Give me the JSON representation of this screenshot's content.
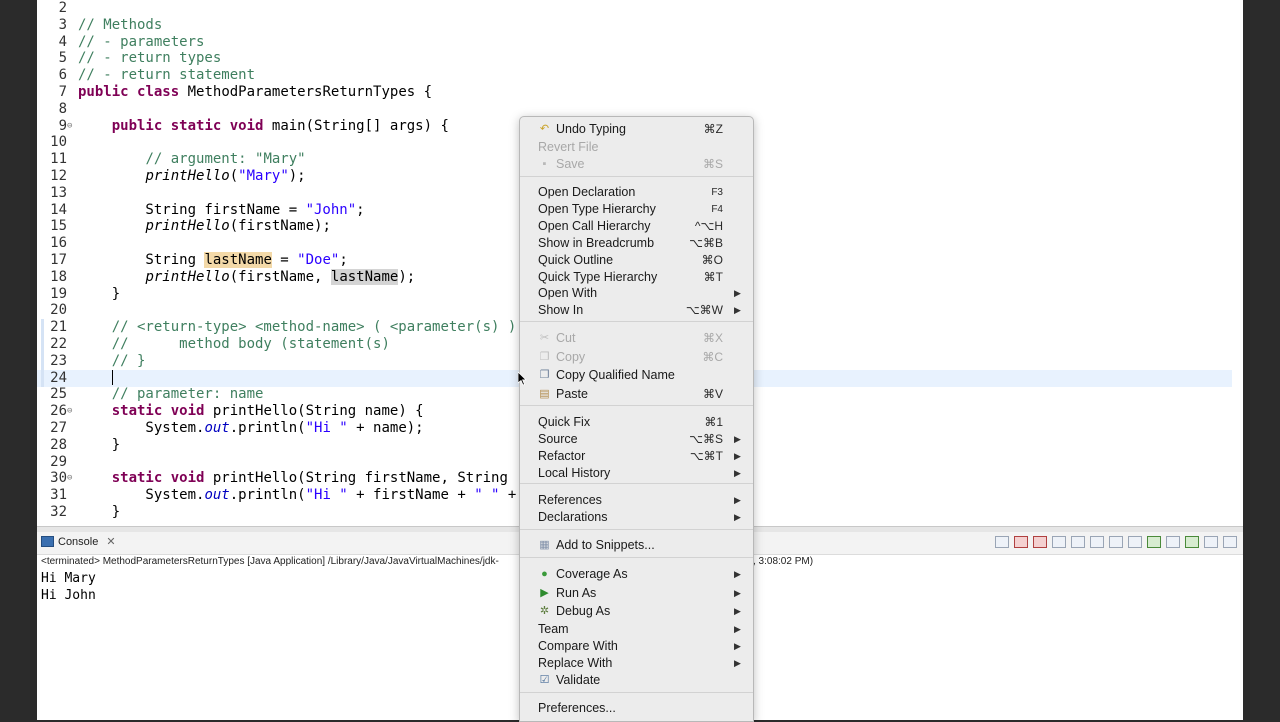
{
  "editor": {
    "lines": [
      {
        "n": "2",
        "c": []
      },
      {
        "n": "3",
        "c": [
          {
            "t": "// Methods",
            "k": "cm"
          }
        ]
      },
      {
        "n": "4",
        "c": [
          {
            "t": "// - parameters",
            "k": "cm"
          }
        ]
      },
      {
        "n": "5",
        "c": [
          {
            "t": "// - return types",
            "k": "cm"
          }
        ]
      },
      {
        "n": "6",
        "c": [
          {
            "t": "// - return statement",
            "k": "cm"
          }
        ]
      },
      {
        "n": "7",
        "c": [
          {
            "t": "public",
            "k": "kw"
          },
          {
            "t": " "
          },
          {
            "t": "class",
            "k": "kw"
          },
          {
            "t": " MethodParametersReturnTypes {"
          }
        ]
      },
      {
        "n": "8",
        "c": []
      },
      {
        "n": "9",
        "fold": true,
        "c": [
          {
            "t": "    "
          },
          {
            "t": "public",
            "k": "kw"
          },
          {
            "t": " "
          },
          {
            "t": "static",
            "k": "kw"
          },
          {
            "t": " "
          },
          {
            "t": "void",
            "k": "kw"
          },
          {
            "t": " main(String[] args) {"
          }
        ]
      },
      {
        "n": "10",
        "c": []
      },
      {
        "n": "11",
        "c": [
          {
            "t": "        "
          },
          {
            "t": "// argument: \"Mary\"",
            "k": "cm"
          }
        ]
      },
      {
        "n": "12",
        "c": [
          {
            "t": "        "
          },
          {
            "t": "printHello",
            "k": "it"
          },
          {
            "t": "("
          },
          {
            "t": "\"Mary\"",
            "k": "st"
          },
          {
            "t": ");"
          }
        ]
      },
      {
        "n": "13",
        "c": []
      },
      {
        "n": "14",
        "c": [
          {
            "t": "        String firstName = "
          },
          {
            "t": "\"John\"",
            "k": "st"
          },
          {
            "t": ";"
          }
        ]
      },
      {
        "n": "15",
        "c": [
          {
            "t": "        "
          },
          {
            "t": "printHello",
            "k": "it"
          },
          {
            "t": "(firstName);"
          }
        ]
      },
      {
        "n": "16",
        "c": []
      },
      {
        "n": "17",
        "c": [
          {
            "t": "        String "
          },
          {
            "t": "lastName",
            "k": "hl-write"
          },
          {
            "t": " = "
          },
          {
            "t": "\"Doe\"",
            "k": "st"
          },
          {
            "t": ";"
          }
        ]
      },
      {
        "n": "18",
        "c": [
          {
            "t": "        "
          },
          {
            "t": "printHello",
            "k": "it"
          },
          {
            "t": "(firstName, "
          },
          {
            "t": "lastName",
            "k": "hl-read"
          },
          {
            "t": ");"
          }
        ]
      },
      {
        "n": "19",
        "c": [
          {
            "t": "    }"
          }
        ]
      },
      {
        "n": "20",
        "c": []
      },
      {
        "n": "21",
        "mark": true,
        "c": [
          {
            "t": "    "
          },
          {
            "t": "// <return-type> <method-name> ( <parameter(s) )",
            "k": "cm"
          }
        ]
      },
      {
        "n": "22",
        "mark": true,
        "c": [
          {
            "t": "    "
          },
          {
            "t": "//      method body (statement(s)",
            "k": "cm"
          }
        ]
      },
      {
        "n": "23",
        "mark": true,
        "c": [
          {
            "t": "    "
          },
          {
            "t": "// }",
            "k": "cm"
          }
        ]
      },
      {
        "n": "24",
        "mark": true,
        "current": true,
        "caret": true,
        "c": [
          {
            "t": "    "
          }
        ]
      },
      {
        "n": "25",
        "c": [
          {
            "t": "    "
          },
          {
            "t": "// parameter: name",
            "k": "cm"
          }
        ]
      },
      {
        "n": "26",
        "fold": true,
        "c": [
          {
            "t": "    "
          },
          {
            "t": "static",
            "k": "kw"
          },
          {
            "t": " "
          },
          {
            "t": "void",
            "k": "kw"
          },
          {
            "t": " printHello(String name) {"
          }
        ]
      },
      {
        "n": "27",
        "c": [
          {
            "t": "        System."
          },
          {
            "t": "out",
            "k": "fld"
          },
          {
            "t": ".println("
          },
          {
            "t": "\"Hi \"",
            "k": "st"
          },
          {
            "t": " + name);"
          }
        ]
      },
      {
        "n": "28",
        "c": [
          {
            "t": "    }"
          }
        ]
      },
      {
        "n": "29",
        "c": []
      },
      {
        "n": "30",
        "fold": true,
        "c": [
          {
            "t": "    "
          },
          {
            "t": "static",
            "k": "kw"
          },
          {
            "t": " "
          },
          {
            "t": "void",
            "k": "kw"
          },
          {
            "t": " printHello(String firstName, String"
          }
        ]
      },
      {
        "n": "31",
        "c": [
          {
            "t": "        System."
          },
          {
            "t": "out",
            "k": "fld"
          },
          {
            "t": ".println("
          },
          {
            "t": "\"Hi \"",
            "k": "st"
          },
          {
            "t": " + firstName + "
          },
          {
            "t": "\" \"",
            "k": "st"
          },
          {
            "t": " +"
          }
        ]
      },
      {
        "n": "32",
        "c": [
          {
            "t": "    }"
          }
        ]
      }
    ]
  },
  "console": {
    "tab_label": "Console",
    "status": "<terminated> MethodParametersReturnTypes [Java Application] /Library/Java/JavaVirtualMachines/jdk-",
    "status_tail": ", 3:08:02 PM)",
    "output": [
      "Hi Mary",
      "Hi John"
    ]
  },
  "menu": {
    "items": [
      {
        "label": "Undo Typing",
        "shortcut": "⌘Z",
        "icon": "undo-icon",
        "glyph": "↶",
        "color": "#c9a227"
      },
      {
        "label": "Revert File",
        "disabled": true
      },
      {
        "label": "Save",
        "shortcut": "⌘S",
        "disabled": true,
        "icon": "save-icon",
        "glyph": "▪",
        "color": "#b8b8b8"
      },
      {
        "sep": true
      },
      {
        "label": "Open Declaration",
        "shortcut": "F3",
        "small": true
      },
      {
        "label": "Open Type Hierarchy",
        "shortcut": "F4",
        "small": true
      },
      {
        "label": "Open Call Hierarchy",
        "shortcut": "^⌥H"
      },
      {
        "label": "Show in Breadcrumb",
        "shortcut": "⌥⌘B"
      },
      {
        "label": "Quick Outline",
        "shortcut": "⌘O"
      },
      {
        "label": "Quick Type Hierarchy",
        "shortcut": "⌘T"
      },
      {
        "label": "Open With",
        "submenu": true
      },
      {
        "label": "Show In",
        "shortcut": "⌥⌘W",
        "submenu": true
      },
      {
        "sep": true
      },
      {
        "label": "Cut",
        "shortcut": "⌘X",
        "disabled": true,
        "icon": "cut-icon",
        "glyph": "✂",
        "color": "#bdbdbd"
      },
      {
        "label": "Copy",
        "shortcut": "⌘C",
        "disabled": true,
        "icon": "copy-icon",
        "glyph": "❐",
        "color": "#bdbdbd"
      },
      {
        "label": "Copy Qualified Name",
        "icon": "copy-qualified-name-icon",
        "glyph": "❐",
        "color": "#6d7f99"
      },
      {
        "label": "Paste",
        "shortcut": "⌘V",
        "icon": "paste-icon",
        "glyph": "▤",
        "color": "#b08a4a"
      },
      {
        "sep": true
      },
      {
        "label": "Quick Fix",
        "shortcut": "⌘1"
      },
      {
        "label": "Source",
        "shortcut": "⌥⌘S",
        "submenu": true
      },
      {
        "label": "Refactor",
        "shortcut": "⌥⌘T",
        "submenu": true
      },
      {
        "label": "Local History",
        "submenu": true
      },
      {
        "sep": true
      },
      {
        "label": "References",
        "submenu": true
      },
      {
        "label": "Declarations",
        "submenu": true
      },
      {
        "sep": true
      },
      {
        "label": "Add to Snippets...",
        "icon": "snippets-icon",
        "glyph": "▦",
        "color": "#7f8fa8"
      },
      {
        "sep": true
      },
      {
        "label": "Coverage As",
        "submenu": true,
        "icon": "coverage-icon",
        "glyph": "●",
        "color": "#3a9a3a"
      },
      {
        "label": "Run As",
        "submenu": true,
        "icon": "run-icon",
        "glyph": "▶",
        "color": "#2e8b2e"
      },
      {
        "label": "Debug As",
        "submenu": true,
        "icon": "debug-icon",
        "glyph": "✲",
        "color": "#5a7a3a"
      },
      {
        "label": "Team",
        "submenu": true
      },
      {
        "label": "Compare With",
        "submenu": true
      },
      {
        "label": "Replace With",
        "submenu": true
      },
      {
        "label": "Validate",
        "icon": "validate-icon",
        "glyph": "☑",
        "color": "#4a6f9a"
      },
      {
        "sep": true
      },
      {
        "label": "Preferences..."
      }
    ]
  }
}
